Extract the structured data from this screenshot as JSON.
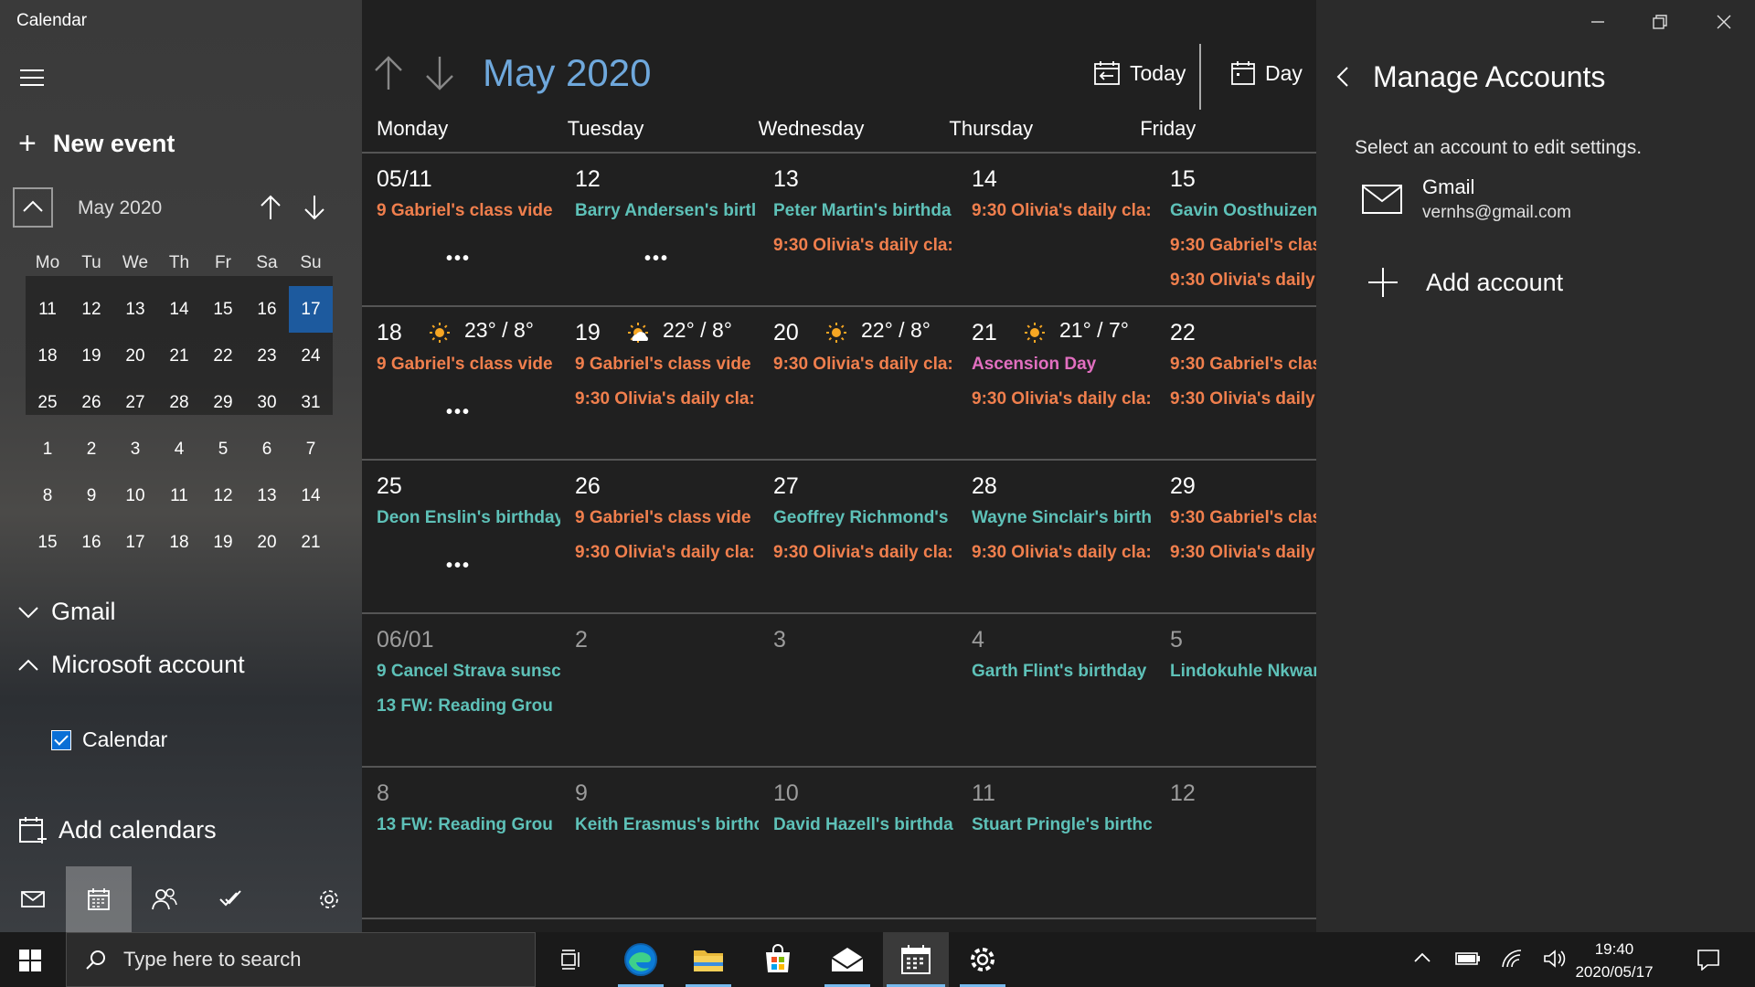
{
  "app": {
    "title": "Calendar"
  },
  "left": {
    "new_event": "New event",
    "mini_month": "May 2020",
    "dow": [
      "Mo",
      "Tu",
      "We",
      "Th",
      "Fr",
      "Sa",
      "Su"
    ],
    "weeks": [
      [
        "11",
        "12",
        "13",
        "14",
        "15",
        "16",
        "17"
      ],
      [
        "18",
        "19",
        "20",
        "21",
        "22",
        "23",
        "24"
      ],
      [
        "25",
        "26",
        "27",
        "28",
        "29",
        "30",
        "31"
      ],
      [
        "1",
        "2",
        "3",
        "4",
        "5",
        "6",
        "7"
      ],
      [
        "8",
        "9",
        "10",
        "11",
        "12",
        "13",
        "14"
      ],
      [
        "15",
        "16",
        "17",
        "18",
        "19",
        "20",
        "21"
      ]
    ],
    "today": "17",
    "groups": {
      "gmail": "Gmail",
      "microsoft": "Microsoft account",
      "calendar": "Calendar"
    },
    "add_calendars": "Add calendars"
  },
  "main": {
    "month_title": "May 2020",
    "today_label": "Today",
    "day_label": "Day",
    "dow": [
      "Monday",
      "Tuesday",
      "Wednesday",
      "Thursday",
      "Friday"
    ],
    "weeks": [
      [
        {
          "num": "05/11",
          "events": [
            {
              "text": "9 Gabriel's class vide",
              "c": "o"
            }
          ],
          "more": "•••"
        },
        {
          "num": "12",
          "events": [
            {
              "text": "Barry Andersen's birtl",
              "c": "t"
            }
          ],
          "more": "•••"
        },
        {
          "num": "13",
          "events": [
            {
              "text": "Peter Martin's birthda",
              "c": "t"
            },
            {
              "text": "9:30 Olivia's daily cla:",
              "c": "o"
            }
          ]
        },
        {
          "num": "14",
          "events": [
            {
              "text": "9:30 Olivia's daily cla:",
              "c": "o"
            }
          ]
        },
        {
          "num": "15",
          "events": [
            {
              "text": "Gavin Oosthuizen'",
              "c": "t"
            },
            {
              "text": "9:30 Gabriel's clas",
              "c": "o"
            },
            {
              "text": "9:30 Olivia's daily",
              "c": "o"
            }
          ]
        }
      ],
      [
        {
          "num": "18",
          "wx": "23° / 8°",
          "events": [
            {
              "text": "9 Gabriel's class vide",
              "c": "o"
            }
          ],
          "more": "•••"
        },
        {
          "num": "19",
          "wx": "22° / 8°",
          "events": [
            {
              "text": "9 Gabriel's class vide",
              "c": "o"
            },
            {
              "text": "9:30 Olivia's daily cla:",
              "c": "o"
            }
          ]
        },
        {
          "num": "20",
          "wx": "22° / 8°",
          "events": [
            {
              "text": "9:30 Olivia's daily cla:",
              "c": "o"
            }
          ]
        },
        {
          "num": "21",
          "wx": "21° / 7°",
          "events": [
            {
              "text": "Ascension Day",
              "c": "p"
            },
            {
              "text": "9:30 Olivia's daily cla:",
              "c": "o"
            }
          ]
        },
        {
          "num": "22",
          "events": [
            {
              "text": "9:30 Gabriel's clas",
              "c": "o"
            },
            {
              "text": "9:30 Olivia's daily",
              "c": "o"
            }
          ]
        }
      ],
      [
        {
          "num": "25",
          "events": [
            {
              "text": "Deon Enslin's birthday",
              "c": "t"
            }
          ],
          "more": "•••"
        },
        {
          "num": "26",
          "events": [
            {
              "text": "9 Gabriel's class vide",
              "c": "o"
            },
            {
              "text": "9:30 Olivia's daily cla:",
              "c": "o"
            }
          ]
        },
        {
          "num": "27",
          "events": [
            {
              "text": "Geoffrey Richmond's",
              "c": "t"
            },
            {
              "text": "9:30 Olivia's daily cla:",
              "c": "o"
            }
          ]
        },
        {
          "num": "28",
          "events": [
            {
              "text": "Wayne Sinclair's birth",
              "c": "t"
            },
            {
              "text": "9:30 Olivia's daily cla:",
              "c": "o"
            }
          ]
        },
        {
          "num": "29",
          "events": [
            {
              "text": "9:30 Gabriel's clas",
              "c": "o"
            },
            {
              "text": "9:30 Olivia's daily",
              "c": "o"
            }
          ]
        }
      ],
      [
        {
          "num": "06/01",
          "dim": true,
          "events": [
            {
              "text": "9 Cancel Strava sunsc",
              "c": "t"
            },
            {
              "text": "13 FW: Reading Grou",
              "c": "t"
            }
          ]
        },
        {
          "num": "2",
          "dim": true,
          "events": []
        },
        {
          "num": "3",
          "dim": true,
          "events": []
        },
        {
          "num": "4",
          "dim": true,
          "events": [
            {
              "text": "Garth Flint's birthday",
              "c": "t"
            }
          ]
        },
        {
          "num": "5",
          "dim": true,
          "events": [
            {
              "text": "Lindokuhle Nkwar",
              "c": "t"
            }
          ]
        }
      ],
      [
        {
          "num": "8",
          "dim": true,
          "events": [
            {
              "text": "13 FW: Reading Grou",
              "c": "t"
            }
          ]
        },
        {
          "num": "9",
          "dim": true,
          "events": [
            {
              "text": "Keith Erasmus's birthc",
              "c": "t"
            }
          ]
        },
        {
          "num": "10",
          "dim": true,
          "events": [
            {
              "text": "David Hazell's birthda",
              "c": "t"
            }
          ]
        },
        {
          "num": "11",
          "dim": true,
          "events": [
            {
              "text": "Stuart Pringle's birthc",
              "c": "t"
            }
          ]
        },
        {
          "num": "12",
          "dim": true,
          "events": []
        }
      ]
    ]
  },
  "manage": {
    "title": "Manage Accounts",
    "subtitle": "Select an account to edit settings.",
    "account_name": "Gmail",
    "account_email": "vernhs@gmail.com",
    "add_account": "Add account"
  },
  "taskbar": {
    "search_placeholder": "Type here to search",
    "time": "19:40",
    "date": "2020/05/17"
  },
  "colors": {
    "accent": "#1d5a9e",
    "title_blue": "#6fa8dc",
    "event_orange": "#f07f4d",
    "event_teal": "#5ec1b8",
    "event_pink": "#e26fc0"
  }
}
